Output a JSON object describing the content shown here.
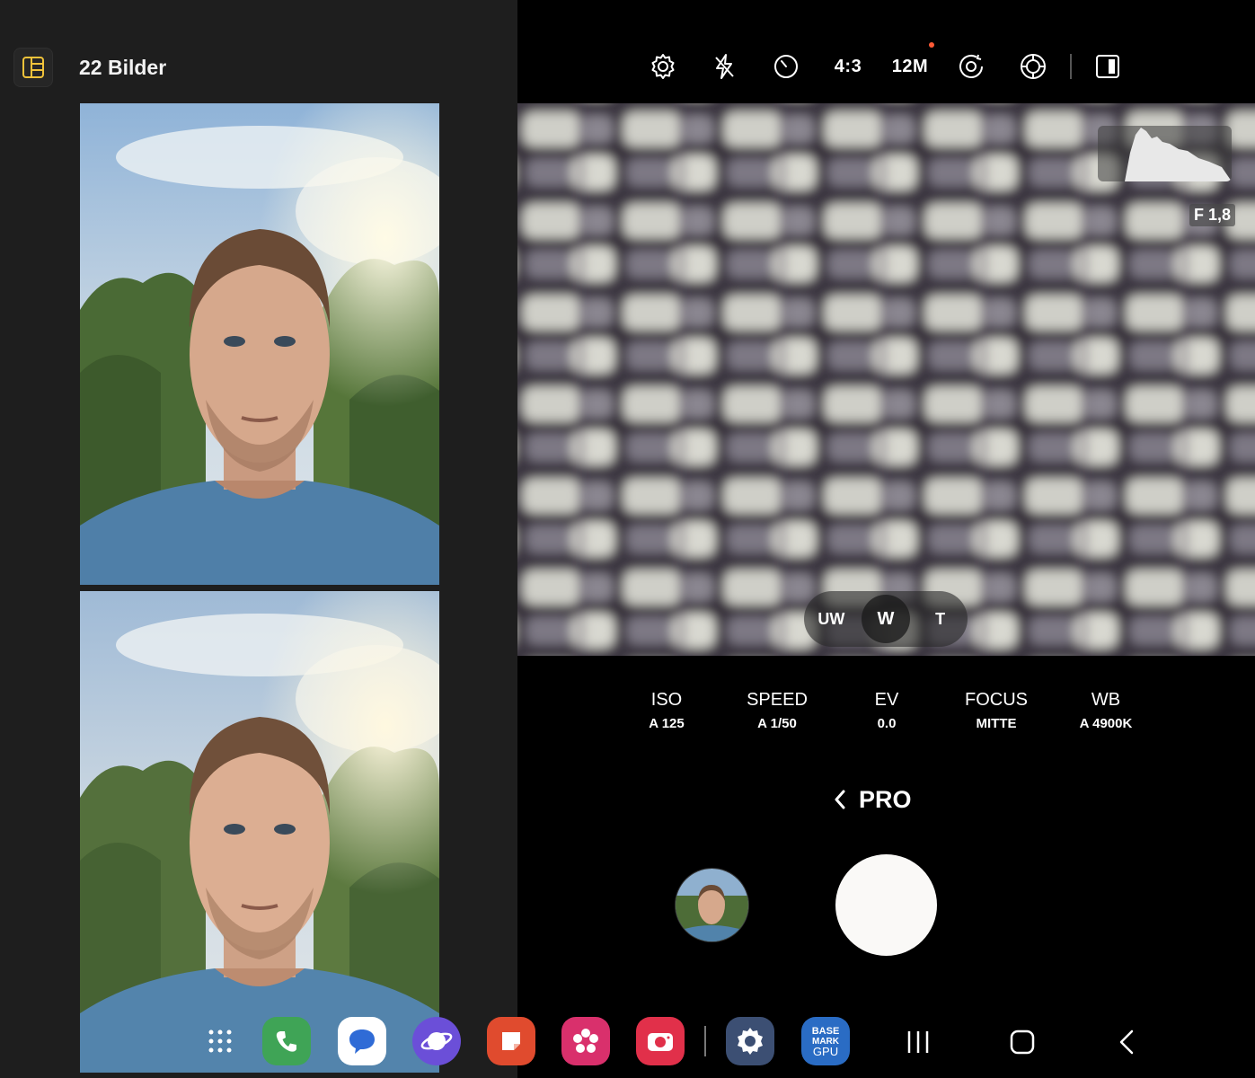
{
  "gallery": {
    "title": "22 Bilder",
    "toggle_icon": "split-view-icon",
    "accent": "#f0c23a",
    "photos": [
      {
        "name": "selfie-photo-1"
      },
      {
        "name": "selfie-photo-2"
      }
    ]
  },
  "camera": {
    "topbar": {
      "settings_icon": "gear-icon",
      "flash_icon": "flash-off-icon",
      "timer_icon": "timer-icon",
      "ratio": "4:3",
      "resolution": "12M",
      "resolution_dot_color": "#ff5a36",
      "motion_icon": "motion-photo-icon",
      "filter_icon": "filter-icon",
      "layout_icon": "dual-view-icon"
    },
    "viewfinder": {
      "aperture": "F 1,8",
      "lenses": [
        {
          "label": "UW",
          "active": false
        },
        {
          "label": "W",
          "active": true
        },
        {
          "label": "T",
          "active": false
        }
      ]
    },
    "pro_controls": [
      {
        "label": "ISO",
        "value": "A 125"
      },
      {
        "label": "SPEED",
        "value": "A 1/50"
      },
      {
        "label": "EV",
        "value": "0.0"
      },
      {
        "label": "FOCUS",
        "value": "MITTE"
      },
      {
        "label": "WB",
        "value": "A 4900K"
      }
    ],
    "mode": {
      "back_icon": "chevron-left-icon",
      "label": "PRO"
    }
  },
  "dock": {
    "apps": [
      {
        "name": "app-drawer-icon",
        "color": "#000000"
      },
      {
        "name": "phone-app-icon",
        "color": "#3fa456"
      },
      {
        "name": "messages-app-icon",
        "color": "#ffffff"
      },
      {
        "name": "internet-app-icon",
        "color": "#6b4fd8"
      },
      {
        "name": "notes-app-icon",
        "color": "#e04b2e"
      },
      {
        "name": "gallery-app-icon",
        "color": "#d9306c"
      },
      {
        "name": "camera-app-icon",
        "color": "#e1304a"
      },
      {
        "name": "settings-app-icon",
        "color": "#3c4f73"
      },
      {
        "name": "basemark-gpu-app-icon",
        "color": "#2a6cc4",
        "label_lines": [
          "BASE",
          "MARK",
          "GPU"
        ]
      }
    ],
    "nav": [
      "recent-apps-icon",
      "home-icon",
      "back-icon"
    ]
  }
}
